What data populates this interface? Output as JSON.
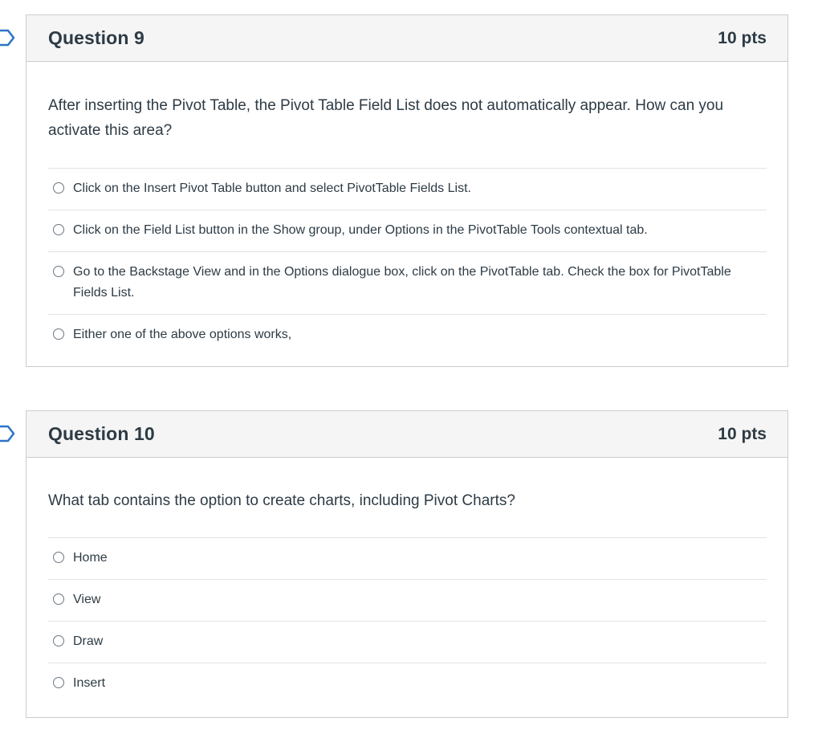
{
  "questions": [
    {
      "title": "Question 9",
      "points": "10 pts",
      "text": "After inserting the Pivot Table, the Pivot Table Field List does not automatically appear. How can you activate this area?",
      "answers": [
        "Click on the Insert Pivot Table button and select PivotTable Fields List.",
        "Click on the Field List button in the Show group, under Options in the PivotTable Tools contextual tab.",
        "Go to the Backstage View and in the Options dialogue box, click on the PivotTable tab. Check the box for PivotTable Fields List.",
        "Either one of the above options works,"
      ]
    },
    {
      "title": "Question 10",
      "points": "10 pts",
      "text": "What tab contains the option to create charts, including Pivot Charts?",
      "answers": [
        "Home",
        "View",
        "Draw",
        "Insert"
      ]
    }
  ],
  "icons": {
    "flag": "flag-outline-icon",
    "radio": "radio-unchecked-icon"
  },
  "colors": {
    "border": "#c7cdd1",
    "header_bg": "#f5f5f5",
    "text": "#2d3b45",
    "divider": "#dfe3e6",
    "flag": "#2d73c8"
  }
}
